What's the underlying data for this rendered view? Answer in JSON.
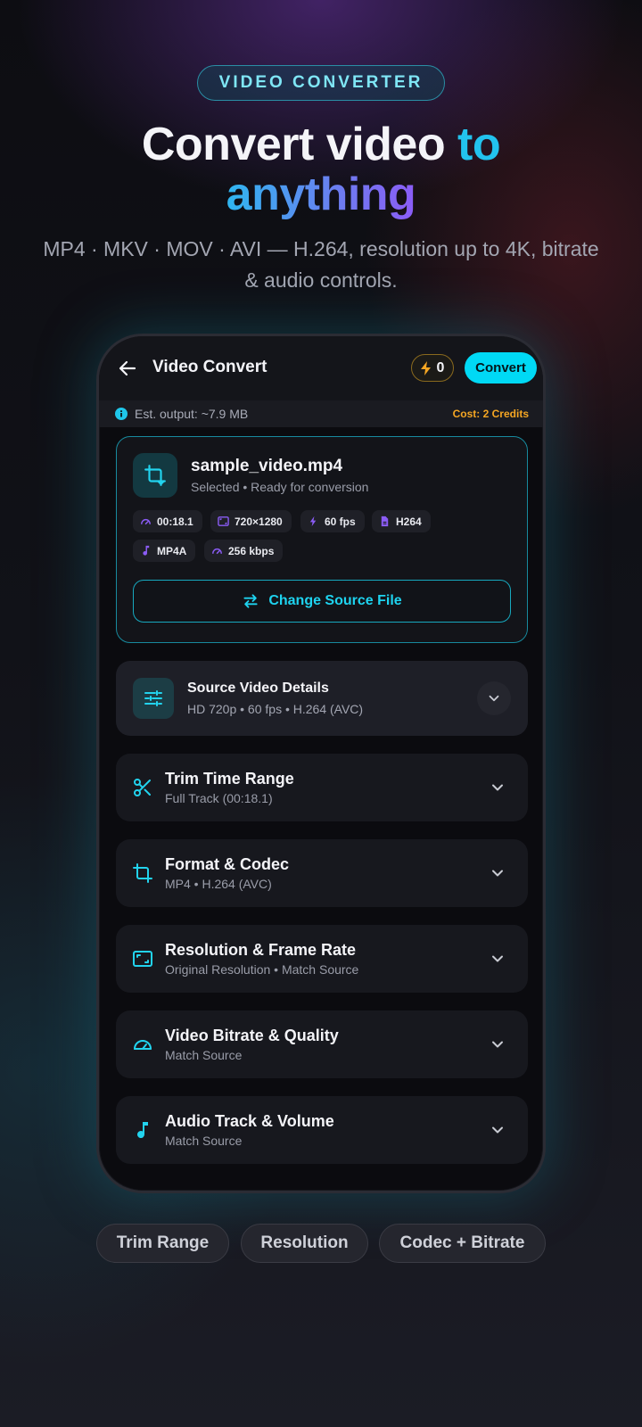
{
  "hero": {
    "badge": "VIDEO CONVERTER",
    "headline_part1": "Convert video ",
    "headline_part2": "to",
    "headline_part3": "anything",
    "subtitle": "MP4 · MKV · MOV · AVI — H.264, resolution up to 4K, bitrate & audio controls."
  },
  "app": {
    "title": "Video Convert",
    "credits": "0",
    "convert_label": "Convert",
    "est_output": "Est. output: ~7.9 MB",
    "cost": "Cost: 2 Credits"
  },
  "file": {
    "name": "sample_video.mp4",
    "status": "Selected • Ready for conversion",
    "chips": [
      {
        "icon": "gauge-icon",
        "label": "00:18.1"
      },
      {
        "icon": "aspect-ratio-icon",
        "label": "720×1280"
      },
      {
        "icon": "bolt-icon",
        "label": "60 fps"
      },
      {
        "icon": "file-icon",
        "label": "H264"
      },
      {
        "icon": "music-note-icon",
        "label": "MP4A"
      },
      {
        "icon": "gauge-icon",
        "label": "256 kbps"
      }
    ],
    "change_label": "Change Source File"
  },
  "details": {
    "title": "Source Video Details",
    "subtitle": "HD 720p • 60 fps • H.264 (AVC)"
  },
  "sections": [
    {
      "icon": "scissors-icon",
      "title": "Trim Time Range",
      "subtitle": "Full Track (00:18.1)"
    },
    {
      "icon": "crop-icon",
      "title": "Format & Codec",
      "subtitle": "MP4 • H.264 (AVC)"
    },
    {
      "icon": "aspect-ratio-icon",
      "title": "Resolution & Frame Rate",
      "subtitle": "Original Resolution • Match Source"
    },
    {
      "icon": "speedometer-icon",
      "title": "Video Bitrate & Quality",
      "subtitle": "Match Source"
    },
    {
      "icon": "music-note-icon",
      "title": "Audio Track & Volume",
      "subtitle": "Match Source"
    }
  ],
  "tags": [
    "Trim Range",
    "Resolution",
    "Codec + Bitrate"
  ],
  "colors": {
    "accent": "#00d9f5",
    "credit": "#f5a623",
    "purple": "#8b5cf6"
  }
}
